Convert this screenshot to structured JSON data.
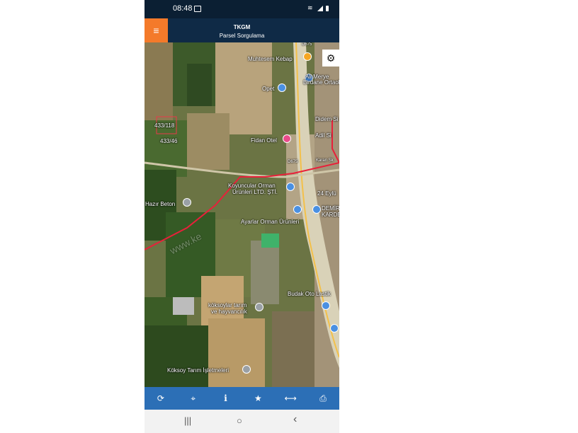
{
  "status_bar": {
    "time": "08:48"
  },
  "header": {
    "title": "TKGM",
    "subtitle": "Parsel Sorgulama"
  },
  "map": {
    "labels": {
      "muhtesem_kebap": "Muhtesem Kebap",
      "ali_merye": "Ali Merye",
      "birdane_ortaokulu": "Birdane Ortaoku",
      "opet": "Opet",
      "didem_si": "Didem Si",
      "adil_si": "Adil Si",
      "parcel_433_118": "433/118",
      "parcel_433_46": "433/46",
      "fidan_otel": "Fidan Otel",
      "road_d675_top": "D675",
      "road_d675_mid": "D675",
      "karan_sk": "Karan Sk",
      "koyuncular_1": "Koyuncular Orman",
      "koyuncular_2": "Ürünleri LTD. ŞTİ.",
      "yirmidort_eylul": "24 Eylü",
      "hazir_beton": "Hazır Beton",
      "demir_1": "DEMİR",
      "demir_2": "KARDE",
      "ayarlar": "Ayarlar Orman Ürünleri",
      "budak_oto": "Budak Oto Lastik",
      "koksoylar_1": "köksoylar tarım",
      "koksoylar_2": "ve hayvancılık",
      "koksoy_isletmeleri": "Köksoy Tarım İşletmeleri",
      "watermark": "www.ke"
    },
    "pin_colors": {
      "food": "#f5a623",
      "blue": "#4a90e2",
      "pink": "#e94b8a"
    }
  },
  "toolbar": {
    "items": [
      {
        "name": "refresh-icon",
        "glyph": "⟳"
      },
      {
        "name": "locate-icon",
        "glyph": "⌖"
      },
      {
        "name": "info-icon",
        "glyph": "i"
      },
      {
        "name": "star-icon",
        "glyph": "★"
      },
      {
        "name": "measure-icon",
        "glyph": "⟷"
      },
      {
        "name": "print-icon",
        "glyph": "⎙"
      }
    ]
  },
  "nav_bar": {
    "recents": "|||",
    "home": "○",
    "back": "‹"
  }
}
